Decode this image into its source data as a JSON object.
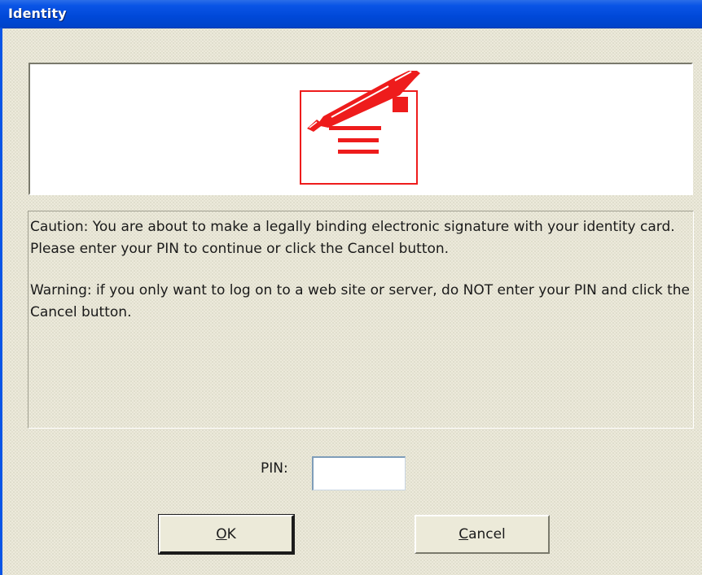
{
  "window": {
    "title": "Identity"
  },
  "banner": {
    "icon": "signature-pen-icon",
    "icon_color": "#ee1c1c"
  },
  "message": {
    "line1": "Caution: You are about to make a legally binding electronic signature with your identity card.",
    "line2": "Please enter your PIN to continue or click the Cancel button.",
    "line3": "Warning: if you only want to log on to a web site or server, do NOT enter your PIN and click the Cancel button."
  },
  "pin": {
    "label": "PIN:",
    "value": ""
  },
  "buttons": {
    "ok_accel": "O",
    "ok_rest": "K",
    "cancel_accel": "C",
    "cancel_rest": "ancel"
  },
  "colors": {
    "titlebar": "#0a55e6",
    "dialog_bg": "#eceadb",
    "accent_red": "#ee1c1c"
  }
}
